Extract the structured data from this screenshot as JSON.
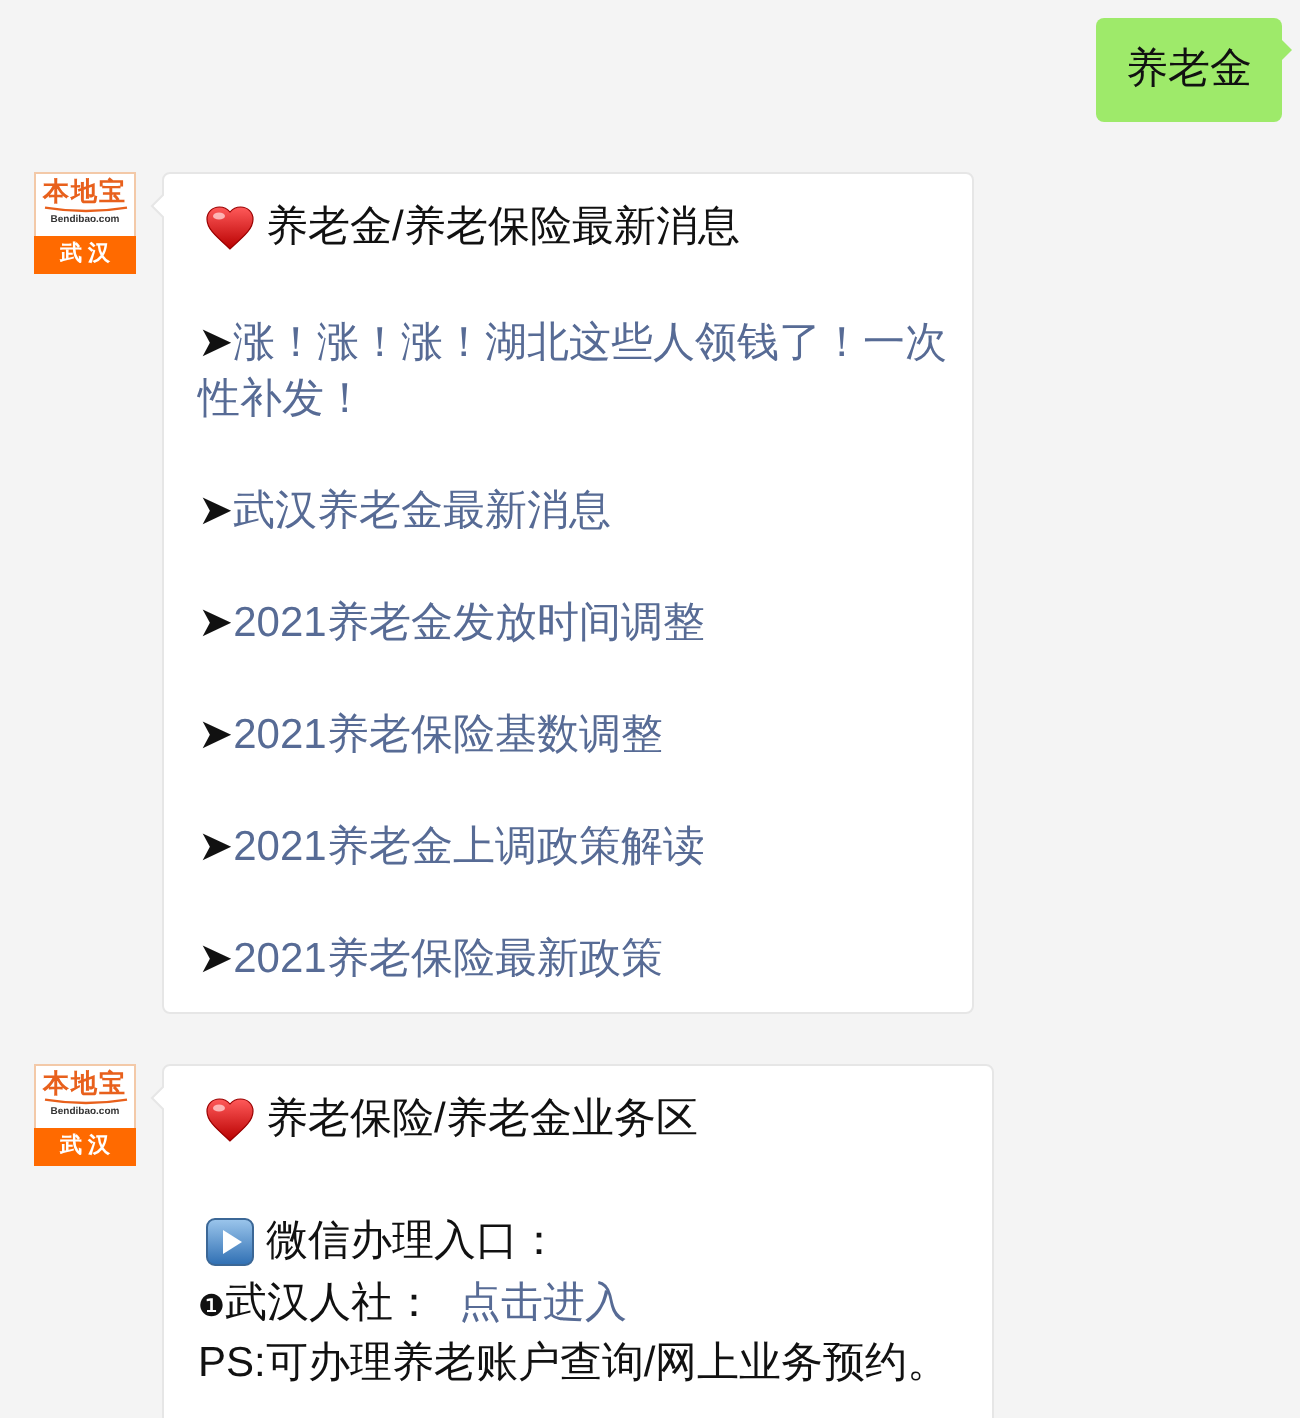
{
  "messages": [
    {
      "kind": "outgoing",
      "text": "养老金"
    },
    {
      "kind": "incoming",
      "avatar": {
        "logo": "本地宝",
        "domain": "Bendibao.com",
        "city": "武汉"
      },
      "title": "养老金/养老保险最新消息",
      "blocks": [
        {
          "kind": "link",
          "bullet": "➤",
          "text": "涨！涨！涨！湖北这些人领钱了！一次性补发！"
        },
        {
          "kind": "link",
          "bullet": "➤",
          "text": "武汉养老金最新消息"
        },
        {
          "kind": "link",
          "bullet": "➤",
          "text": "2021养老金发放时间调整"
        },
        {
          "kind": "link",
          "bullet": "➤",
          "text": "2021养老保险基数调整"
        },
        {
          "kind": "link",
          "bullet": "➤",
          "text": "2021养老金上调政策解读"
        },
        {
          "kind": "link",
          "bullet": "➤",
          "text": "2021养老保险最新政策"
        }
      ]
    },
    {
      "kind": "incoming",
      "avatar": {
        "logo": "本地宝",
        "domain": "Bendibao.com",
        "city": "武汉"
      },
      "title": "养老保险/养老金业务区",
      "blocks": [
        {
          "kind": "heading",
          "text": "微信办理入口："
        },
        {
          "kind": "entry",
          "marker": "❶",
          "label": "武汉人社：",
          "link": "点击进入"
        },
        {
          "kind": "note",
          "text": "PS:可办理养老账户查询/网上业务预约。"
        }
      ]
    }
  ]
}
